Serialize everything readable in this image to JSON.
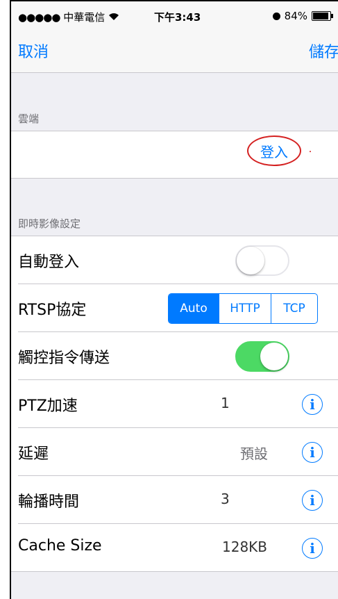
{
  "status_bar": {
    "signal_dots": "●●●●●",
    "carrier": "中華電信",
    "wifi_icon": "wifi-icon",
    "time": "下午3:43",
    "battery_percent": "84%",
    "battery_level": 0.84
  },
  "nav": {
    "cancel_label": "取消",
    "save_label": "儲存"
  },
  "cloud_section": {
    "header": "雲端",
    "login_label": "登入",
    "annotation_color": "#d42020"
  },
  "live_section": {
    "header": "即時影像設定",
    "rows": [
      {
        "label": "自動登入",
        "type": "toggle",
        "on": false
      },
      {
        "label": "RTSP協定",
        "type": "segmented",
        "options": [
          "Auto",
          "HTTP",
          "TCP"
        ],
        "selected": "Auto"
      },
      {
        "label": "觸控指令傳送",
        "type": "toggle",
        "on": true
      },
      {
        "label": "PTZ加速",
        "type": "value_info",
        "value": "1"
      },
      {
        "label": "延遲",
        "type": "value_info",
        "value": "預設"
      },
      {
        "label": "輪播時間",
        "type": "value_info",
        "value": "3"
      },
      {
        "label": "Cache Size",
        "type": "value_info",
        "value": "128KB"
      }
    ],
    "info_glyph": "i"
  },
  "colors": {
    "accent": "#007aff",
    "toggle_on": "#4cd964",
    "background": "#efeff4"
  }
}
